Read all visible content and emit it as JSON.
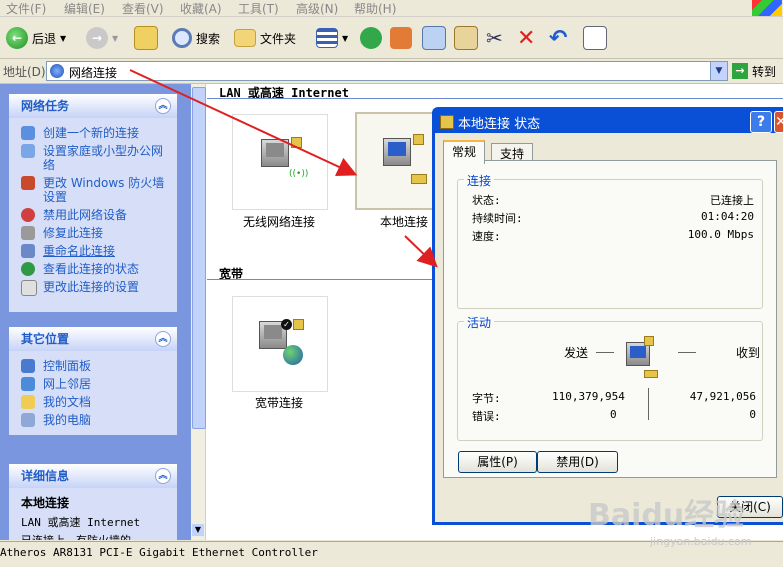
{
  "menubar": {
    "items": [
      "文件(F)",
      "编辑(E)",
      "查看(V)",
      "收藏(A)",
      "工具(T)",
      "高级(N)",
      "帮助(H)"
    ]
  },
  "toolbar": {
    "back_label": "后退",
    "search_label": "搜索",
    "folders_label": "文件夹"
  },
  "address": {
    "label": "地址(D)",
    "value": "网络连接",
    "go_label": "转到"
  },
  "left_pane": {
    "network_tasks": {
      "title": "网络任务",
      "items": [
        "创建一个新的连接",
        "设置家庭或小型办公网络",
        "更改 Windows 防火墙设置",
        "禁用此网络设备",
        "修复此连接",
        "重命名此连接",
        "查看此连接的状态",
        "更改此连接的设置"
      ]
    },
    "other_places": {
      "title": "其它位置",
      "items": [
        "控制面板",
        "网上邻居",
        "我的文档",
        "我的电脑"
      ]
    },
    "details": {
      "title": "详细信息",
      "name": "本地连接",
      "type": "LAN 或高速 Internet",
      "status_partial": "已连接上，有防火墙的"
    }
  },
  "right_pane": {
    "lan_section_title": "LAN 或高速 Internet",
    "broadband_section_title": "宽带",
    "connections": {
      "wireless": "无线网络连接",
      "local": "本地连接",
      "broadband": "宽带连接"
    }
  },
  "status_bar": {
    "text": "Atheros AR8131 PCI-E Gigabit Ethernet Controller"
  },
  "dialog": {
    "title": "本地连接 状态",
    "tabs": [
      "常规",
      "支持"
    ],
    "connection_group": {
      "title": "连接",
      "rows": [
        {
          "label": "状态:",
          "value": "已连接上"
        },
        {
          "label": "持续时间:",
          "value": "01:04:20"
        },
        {
          "label": "速度:",
          "value": "100.0 Mbps"
        }
      ]
    },
    "activity_group": {
      "title": "活动",
      "sent_label": "发送",
      "received_label": "收到",
      "bytes_label": "字节:",
      "bytes_sent": "110,379,954",
      "bytes_received": "47,921,056",
      "errors_label": "错误:",
      "errors_sent": "0",
      "errors_received": "0"
    },
    "properties_button": "属性(P)",
    "disable_button": "禁用(D)",
    "close_button": "关闭(C)"
  },
  "watermark": {
    "text": "Baidu经验",
    "url": "jingyan.baidu.com"
  },
  "colors": {
    "xp_blue": "#0a50d6",
    "link_blue": "#215dc6",
    "arrow_red": "#e02020"
  }
}
